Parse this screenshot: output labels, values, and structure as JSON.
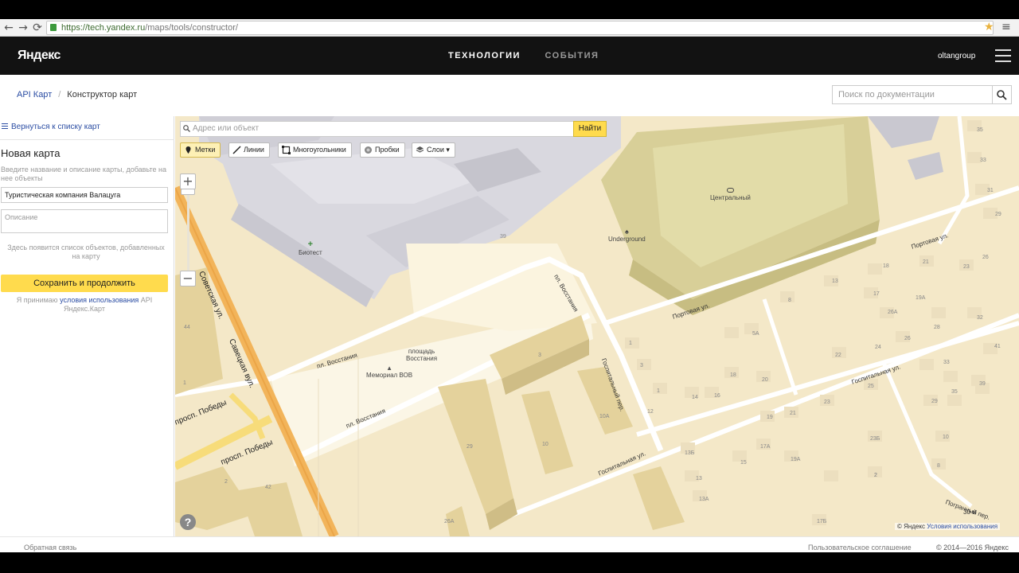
{
  "browser": {
    "url_scheme": "https://",
    "url_host": "tech.yandex.ru",
    "url_path": "/maps/tools/constructor/"
  },
  "header": {
    "logo": "Яндекс",
    "nav": [
      "ТЕХНОЛОГИИ",
      "СОБЫТИЯ"
    ],
    "user": "oltangroup"
  },
  "breadcrumb": {
    "root": "API Карт",
    "current": "Конструктор карт"
  },
  "doc_search": {
    "placeholder": "Поиск по документации"
  },
  "sidebar": {
    "back_link": "Вернуться к списку карт",
    "title": "Новая карта",
    "hint": "Введите название и описание карты, добавьте на нее объекты",
    "name_value": "Туристическая компания Валацуга",
    "description_placeholder": "Описание",
    "empty_list_note": "Здесь появится список объектов, добавленных на карту",
    "save_button": "Сохранить и продолжить",
    "terms_prefix": "Я принимаю",
    "terms_link": "условия использования",
    "terms_suffix": "API Яндекс.Карт"
  },
  "map": {
    "address_placeholder": "Адрес или объект",
    "find_button": "Найти",
    "tools": [
      "Метки",
      "Линии",
      "Многоугольники",
      "Пробки",
      "Слои"
    ],
    "active_tool": "Метки",
    "labels": {
      "stadium": "Центральный",
      "underground": "Underground",
      "biotest": "Биотест",
      "memorial": "Мемориал ВОВ",
      "square": "площадь\nВосстания",
      "sovetskaya": "Советская ул.",
      "savetskaya": "Савецкая вул.",
      "pobedy_1": "просп. Победы",
      "pobedy_2": "просп. Победы",
      "vosstaniya_1": "пл. Восстания",
      "vosstaniya_2": "пл. Восстания",
      "vosstaniya_3": "пл. Восстания",
      "portovaya_1": "Портовая ул.",
      "portovaya_2": "Портовая ул.",
      "gospitalnaya_1": "Госпитальная ул.",
      "gospitalnaya_2": "Госпитальная ул.",
      "gospitalny_per": "Госпитальный пер.",
      "pogranny_per": "Погранный пер."
    },
    "house_numbers": [
      "35",
      "33",
      "31",
      "29",
      "26",
      "21",
      "18",
      "23",
      "13",
      "17",
      "19А",
      "26А",
      "32",
      "8",
      "28",
      "26",
      "5А",
      "41",
      "1",
      "22",
      "24",
      "33",
      "3",
      "20",
      "18",
      "25",
      "1",
      "14",
      "16",
      "23",
      "35",
      "39",
      "12",
      "10А",
      "19",
      "21",
      "29",
      "2",
      "23Б",
      "10",
      "13Б",
      "17А",
      "15",
      "19А",
      "8",
      "13",
      "2",
      "13А",
      "17Б",
      "44",
      "1",
      "2",
      "42",
      "29",
      "10",
      "26А",
      "3",
      "39"
    ],
    "copyright": "© Яндекс",
    "copyright_link": "Условия использования",
    "scale": "30 м"
  },
  "footer": {
    "feedback": "Обратная связь",
    "agreement": "Пользовательское соглашение",
    "copyright": "© 2014—2016 Яндекс"
  }
}
